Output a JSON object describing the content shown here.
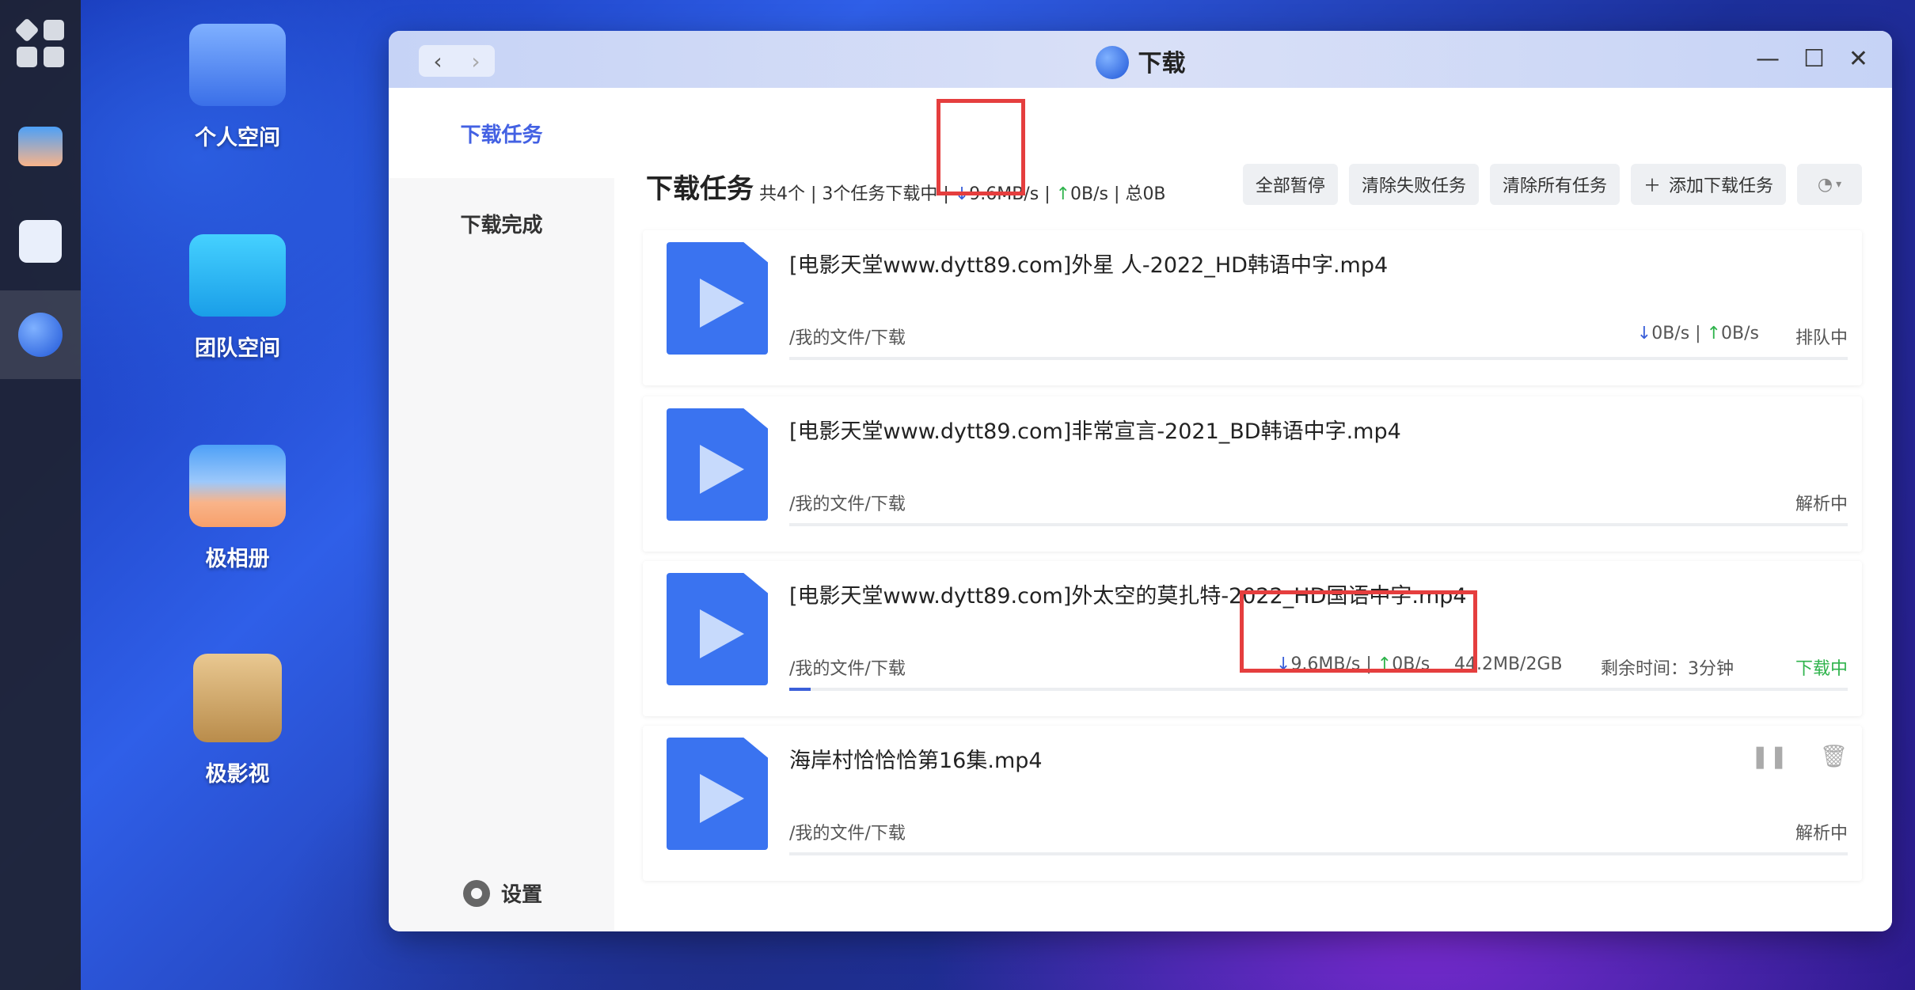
{
  "desktop": {
    "icons": [
      {
        "label": "个人空间"
      },
      {
        "label": "团队空间"
      },
      {
        "label": "极相册"
      },
      {
        "label": "极影视"
      }
    ]
  },
  "window": {
    "title": "下载",
    "nav_back": "‹",
    "nav_forward": "›"
  },
  "sidebar": {
    "items": [
      {
        "label": "下载任务"
      },
      {
        "label": "下载完成"
      }
    ],
    "settings_label": "设置"
  },
  "header": {
    "title": "下载任务",
    "summary_prefix": "共4个 | 3个任务下载中 |",
    "down_speed": "9.6MB/s",
    "sep1": "|",
    "up_speed": "0B/s",
    "sep2": "|",
    "total": "总0B"
  },
  "actions": {
    "pause_all": "全部暂停",
    "clear_failed": "清除失败任务",
    "clear_all": "清除所有任务",
    "add_task": "添加下载任务"
  },
  "tasks": [
    {
      "name": "[电影天堂www.dytt89.com]外星 人-2022_HD韩语中字.mp4",
      "path": "/我的文件/下载",
      "down": "0B/s",
      "up": "0B/s",
      "status": "排队中",
      "progress": 0
    },
    {
      "name": "[电影天堂www.dytt89.com]非常宣言-2021_BD韩语中字.mp4",
      "path": "/我的文件/下载",
      "status": "解析中",
      "progress": 0
    },
    {
      "name": "[电影天堂www.dytt89.com]外太空的莫扎特-2022_HD国语中字.mp4",
      "path": "/我的文件/下载",
      "down": "9.6MB/s",
      "up": "0B/s",
      "size": "44.2MB/2GB",
      "remaining": "剩余时间：3分钟",
      "status": "下载中",
      "progress": 0.02
    },
    {
      "name": "海岸村恰恰恰第16集.mp4",
      "path": "/我的文件/下载",
      "status": "解析中",
      "progress": 0
    }
  ],
  "colors": {
    "accent": "#4361e3",
    "download_arrow": "#3a5fd9",
    "upload_arrow": "#2fb34c",
    "highlight": "#e53e3e"
  }
}
